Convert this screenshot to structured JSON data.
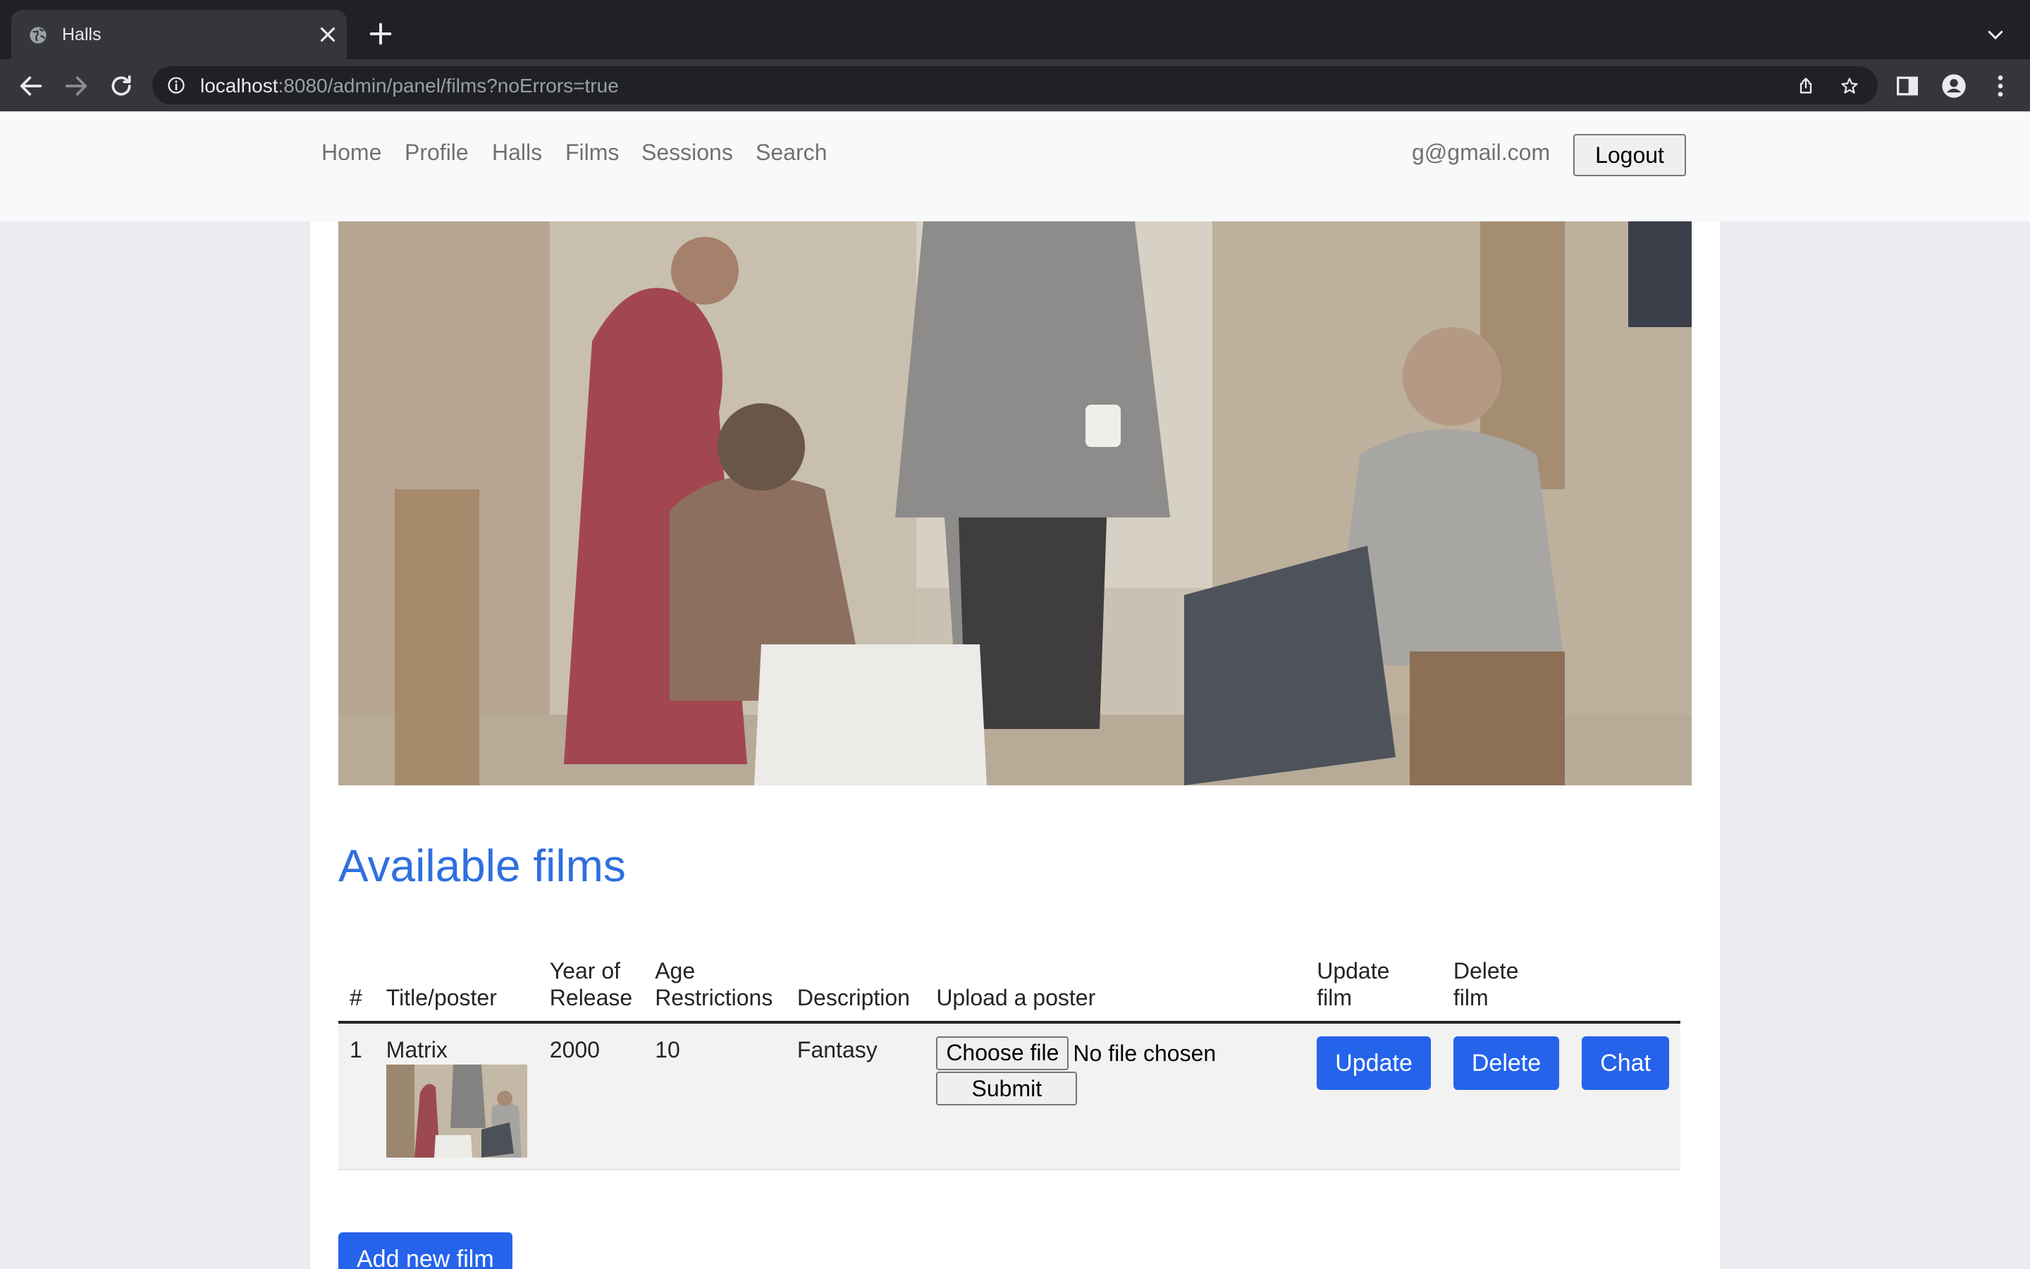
{
  "browser": {
    "tab_title": "Halls",
    "url_host": "localhost",
    "url_path": ":8080/admin/panel/films?noErrors=true"
  },
  "navbar": {
    "links": [
      "Home",
      "Profile",
      "Halls",
      "Films",
      "Sessions",
      "Search"
    ],
    "user_email": "g@gmail.com",
    "logout_label": "Logout"
  },
  "main": {
    "title": "Available films",
    "table": {
      "headers": [
        "#",
        "Title/poster",
        "Year of Release",
        "Age Restrictions",
        "Description",
        "Upload a poster",
        "Update film",
        "Delete film",
        ""
      ],
      "rows": [
        {
          "num": "1",
          "title": "Matrix",
          "year": "2000",
          "age": "10",
          "description": "Fantasy",
          "choose_file_label": "Choose file",
          "file_status": "No file chosen",
          "submit_label": "Submit",
          "update_label": "Update",
          "delete_label": "Delete",
          "chat_label": "Chat"
        }
      ]
    },
    "add_film_label": "Add new film"
  },
  "colors": {
    "accent": "#2563eb",
    "title": "#2f6fe0",
    "chrome_dark": "#202124",
    "chrome_toolbar": "#35363a"
  },
  "icons": [
    "globe-icon",
    "close-icon",
    "plus-icon",
    "chevron-down-icon",
    "back-arrow-icon",
    "forward-arrow-icon",
    "reload-icon",
    "info-icon",
    "share-icon",
    "star-icon",
    "side-panel-icon",
    "profile-icon",
    "more-vert-icon"
  ]
}
